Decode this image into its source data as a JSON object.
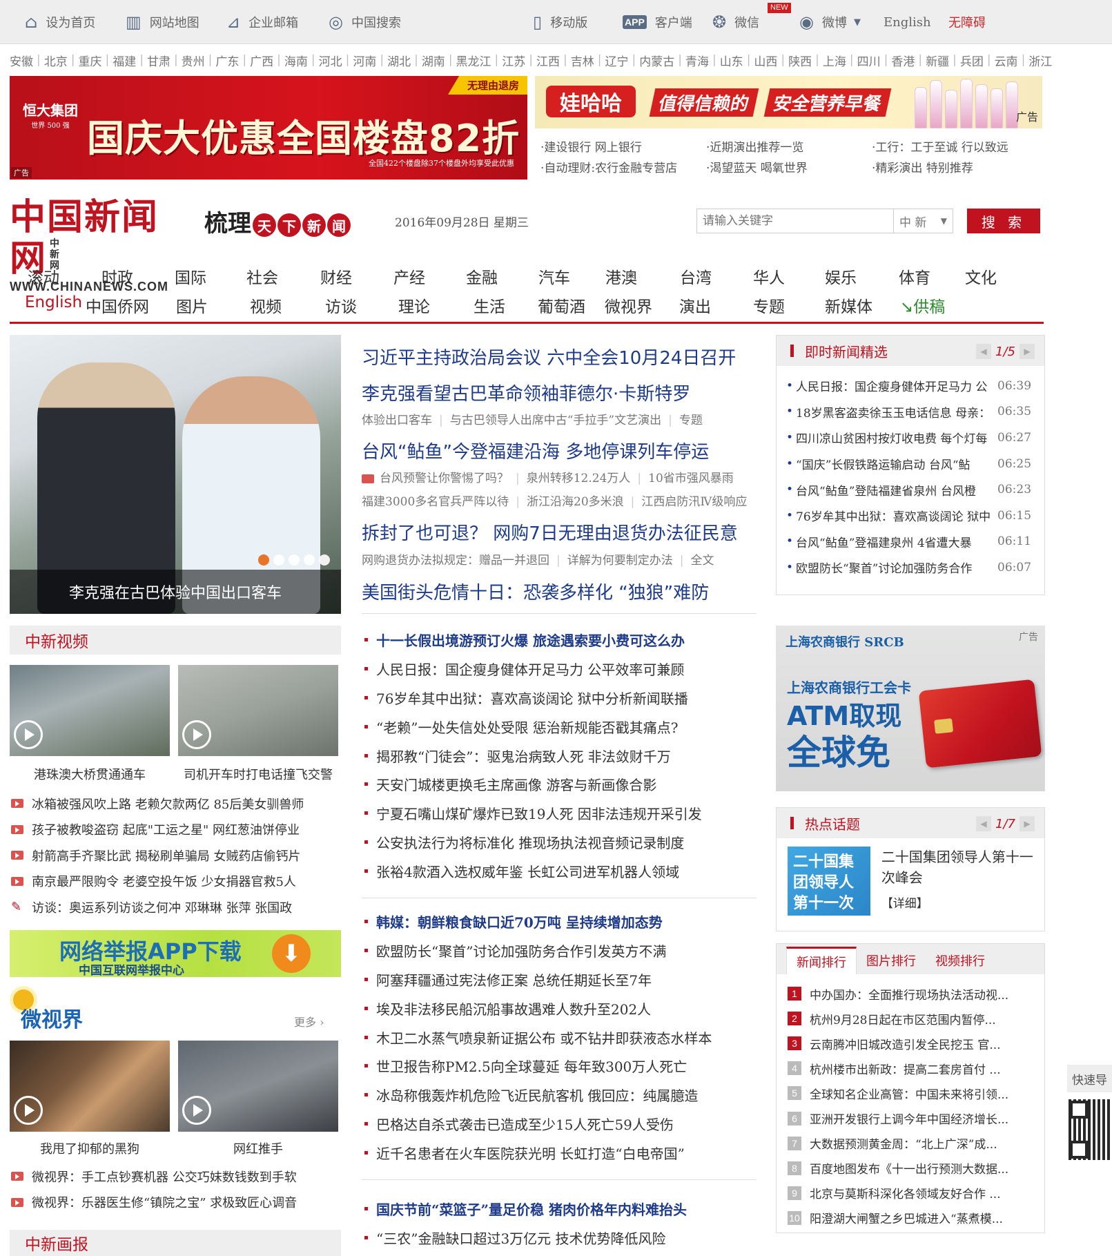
{
  "topbar": {
    "home": "设为首页",
    "sitemap": "网站地图",
    "mail": "企业邮箱",
    "search": "中国搜索",
    "mobile": "移动版",
    "client": "客户端",
    "wechat": "微信",
    "new_badge": "NEW",
    "weibo": "微博",
    "english": "English",
    "accessible": "无障碍"
  },
  "regions": [
    "安徽",
    "北京",
    "重庆",
    "福建",
    "甘肃",
    "贵州",
    "广东",
    "广西",
    "海南",
    "河北",
    "河南",
    "湖北",
    "湖南",
    "黑龙江",
    "江苏",
    "江西",
    "吉林",
    "辽宁",
    "内蒙古",
    "青海",
    "山东",
    "山西",
    "陕西",
    "上海",
    "四川",
    "香港",
    "新疆",
    "兵团",
    "云南",
    "浙江"
  ],
  "ads": {
    "evergrande_tag": "无理由退房",
    "evergrande_logo_line1": "恒大集团",
    "evergrande_logo_line2": "世界 500 强",
    "evergrande_headline": "国庆大优惠全国楼盘82折",
    "evergrande_sub": "全国422个楼盘除37个楼盘外均享受此优惠",
    "ad_label": "广告",
    "wahaha_brand": "娃哈哈",
    "wahaha_slogan1": "值得信赖的",
    "wahaha_slogan2": "安全营养早餐",
    "wahaha_label": "广告",
    "links": [
      [
        "·建设银行 网上银行",
        "·近期演出推荐一览",
        "·工行：工于至诚 行以致远"
      ],
      [
        "·自动理财:农行金融专营店",
        "·渴望蓝天 喝氧世界",
        "·精彩演出 特别推荐"
      ]
    ]
  },
  "header": {
    "logo_cn": "中国新闻网",
    "logo_small": "中新网",
    "logo_url": "WWW.CHINANEWS.COM",
    "slogan": "梳理天下新闻",
    "date": "2016年09月28日 星期三",
    "search_placeholder": "请输入关键字",
    "search_scope": "中 新",
    "search_button": "搜 索"
  },
  "nav": {
    "row1": [
      "滚动",
      "时政",
      "国际",
      "社会",
      "财经",
      "产经",
      "金融",
      "汽车",
      "港澳",
      "台湾",
      "华人",
      "娱乐",
      "体育",
      "文化"
    ],
    "row2": [
      "English",
      "中国侨网",
      "图片",
      "视频",
      "访谈",
      "理论",
      "生活",
      "葡萄酒",
      "微视界",
      "演出",
      "专题",
      "新媒体",
      "供稿"
    ]
  },
  "focus": {
    "caption": "李克强在古巴体验中国出口客车"
  },
  "headlines": {
    "h1": "习近平主持政治局会议 六中全会10月24日召开",
    "h2": "李克强看望古巴革命领袖菲德尔·卡斯特罗",
    "h2_subs": [
      "体验出口客车",
      "与古巴领导人出席中古“手拉手”文艺演出",
      "专题"
    ],
    "h3": "台风“鲇鱼”今登福建沿海 多地停课列车停运",
    "h3_subs1": [
      "台风预警让你警惕了吗？",
      "泉州转移12.24万人",
      "10省市强风暴雨"
    ],
    "h3_subs2": [
      "福建3000多名官兵严阵以待",
      "浙江沿海20多米浪",
      "江西启防汛Ⅳ级响应"
    ],
    "h4": "拆封了也可退？ 网购7日无理由退货办法征民意",
    "h4_subs": [
      "网购退货办法拟规定：赠品一并退回",
      "详解为何要制定办法",
      "全文"
    ],
    "h5": "美国街头危情十日：恐袭多样化 “独狼”难防"
  },
  "news_list_1": [
    "十一长假出境游预订火爆 旅途遇索要小费可这么办",
    "人民日报：国企瘦身健体开足马力 公平效率可兼顾",
    "76岁牟其中出狱：喜欢高谈阔论 狱中分析新闻联播",
    "“老赖”一处失信处处受限 惩治新规能否戳其痛点?",
    "揭邪教“门徒会”：驱鬼治病致人死 非法敛财千万",
    "天安门城楼更换毛主席画像 游客与新画像合影",
    "宁夏石嘴山煤矿爆炸已致19人死 因非法违规开采引发",
    "公安执法行为将标准化 推现场执法视音频记录制度",
    "张裕4款酒入选权威年鉴 长虹公司进军机器人领域"
  ],
  "news_list_2": [
    "韩媒：朝鲜粮食缺口近70万吨 呈持续增加态势",
    "欧盟防长“聚首”讨论加强防务合作引发英方不满",
    "阿塞拜疆通过宪法修正案 总统任期延长至7年",
    "埃及非法移民船沉船事故遇难人数升至202人",
    "木卫二水蒸气喷泉新证据公布 或不钻井即获液态水样本",
    "世卫报告称PM2.5向全球蔓延 每年致300万人死亡",
    "冰岛称俄轰炸机危险飞近民航客机 俄回应：纯属臆造",
    "巴格达自杀式袭击已造成至少15人死亡59人受伤",
    "近千名患者在火车医院获光明 长虹打造“白电帝国”"
  ],
  "news_list_3": [
    "国庆节前“菜篮子”量足价稳 猪肉价格年内料难抬头",
    "“三农”金融缺口超过3万亿元 技术优势降低风险"
  ],
  "video": {
    "title": "中新视频",
    "thumbs": [
      "港珠澳大桥贯通通车",
      "司机开车时打电话撞飞交警"
    ],
    "list": [
      "冰箱被强风吹上路 老赖欠款两亿 85后美女驯兽师",
      "孩子被教唆盗窃 起底\"工运之星\" 网红葱油饼停业",
      "射箭高手齐聚比武 揭秘刷单骗局 女贼药店偷钙片",
      "南京最严限购令 老婆空投午饭 少女捐器官救5人",
      "访谈：奥运系列访谈之何冲 邓琳琳 张萍 张国政"
    ]
  },
  "report_ad": {
    "title": "网络举报APP下载",
    "sub": "中国互联网举报中心"
  },
  "weishijie": {
    "logo": "微视界",
    "more": "更多",
    "thumbs": [
      "我甩了抑郁的黑狗",
      "网红推手"
    ],
    "list": [
      "微视界：手工点钞赛机器 公交巧妹数钱数到手软",
      "微视界：乐器医生修“镇院之宝” 求极致匠心调音"
    ]
  },
  "photo_section": {
    "title": "中新画报"
  },
  "instant": {
    "title": "即时新闻精选",
    "pager": "1/5",
    "items": [
      {
        "t": "人民日报：国企瘦身健体开足马力 公",
        "tm": "06:39"
      },
      {
        "t": "18岁黑客盗卖徐玉玉电话信息 母亲：",
        "tm": "06:35"
      },
      {
        "t": "四川凉山贫困村按灯收电费 每个灯每",
        "tm": "06:27"
      },
      {
        "t": "“国庆”长假铁路运输启动 台风“鲇",
        "tm": "06:25"
      },
      {
        "t": "台风“鲇鱼”登陆福建省泉州 台风橙",
        "tm": "06:23"
      },
      {
        "t": "76岁牟其中出狱：喜欢高谈阔论 狱中",
        "tm": "06:15"
      },
      {
        "t": "台风“鲇鱼”登福建泉州 4省遭大暴",
        "tm": "06:11"
      },
      {
        "t": "欧盟防长“聚首”讨论加强防务合作",
        "tm": "06:07"
      }
    ]
  },
  "srcb_ad": {
    "brand": "上海农商银行 SRCB",
    "label": "广告",
    "line1": "上海农商银行工会卡",
    "line2": "ATM取现",
    "line3": "全球免"
  },
  "hot": {
    "title": "热点话题",
    "pager": "1/7",
    "img_text": "二十国集团领导人第十一次峰会",
    "text": "二十国集团领导人第十一次峰会",
    "detail": "【详细】"
  },
  "rank": {
    "tabs": [
      "新闻排行",
      "图片排行",
      "视频排行"
    ],
    "items": [
      "中办国办：全面推行现场执法活动视...",
      "杭州9月28日起在市区范围内暂停...",
      "云南腾冲旧城改造引发全民挖玉 官...",
      "杭州楼市出新政：提高二套房首付 ...",
      "全球知名企业高管：中国未来将引领...",
      "亚洲开发银行上调今年中国经济增长...",
      "大数据预测黄金周：“北上广深”成...",
      "百度地图发布《十一出行预测大数据...",
      "北京与莫斯科深化各领域友好合作 ...",
      "阳澄湖大闸蟹之乡巴城进入“蒸煮模..."
    ]
  },
  "quick_nav": "快速导"
}
